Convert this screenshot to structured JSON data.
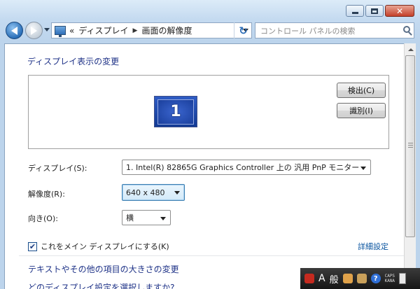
{
  "window": {
    "caption": {
      "minimize": "minimize",
      "maximize": "maximize",
      "close": "close"
    }
  },
  "nav": {
    "address": {
      "chevron": "«",
      "seg1": "ディスプレイ",
      "sep": "▶",
      "seg2": "画面の解像度"
    },
    "search_placeholder": "コントロール パネルの検索"
  },
  "main": {
    "heading": "ディスプレイ表示の変更",
    "monitor_number": "1",
    "detect_button": "検出(C)",
    "identify_button": "識別(I)",
    "display_label": "ディスプレイ(S):",
    "display_value": "1. Intel(R) 82865G Graphics Controller 上の 汎用 PnP モニター",
    "resolution_label": "解像度(R):",
    "resolution_value": "640 x 480",
    "orientation_label": "向き(O):",
    "orientation_value": "横",
    "primary_checkbox_label": "これをメイン ディスプレイにする(K)",
    "primary_checked": true,
    "advanced_link": "詳細設定",
    "text_size_link": "テキストやその他の項目の大きさの変更",
    "partial_link": "どのディスプレイ設定を選択しますか?"
  },
  "taskbar": {
    "ime_mode": "A",
    "ime_kanji": "般",
    "caps": "CAPS",
    "kana": "KANA"
  },
  "colors": {
    "link": "#1e3287",
    "accent": "#2f6fb8",
    "taskbar": "#1e1e1e"
  }
}
